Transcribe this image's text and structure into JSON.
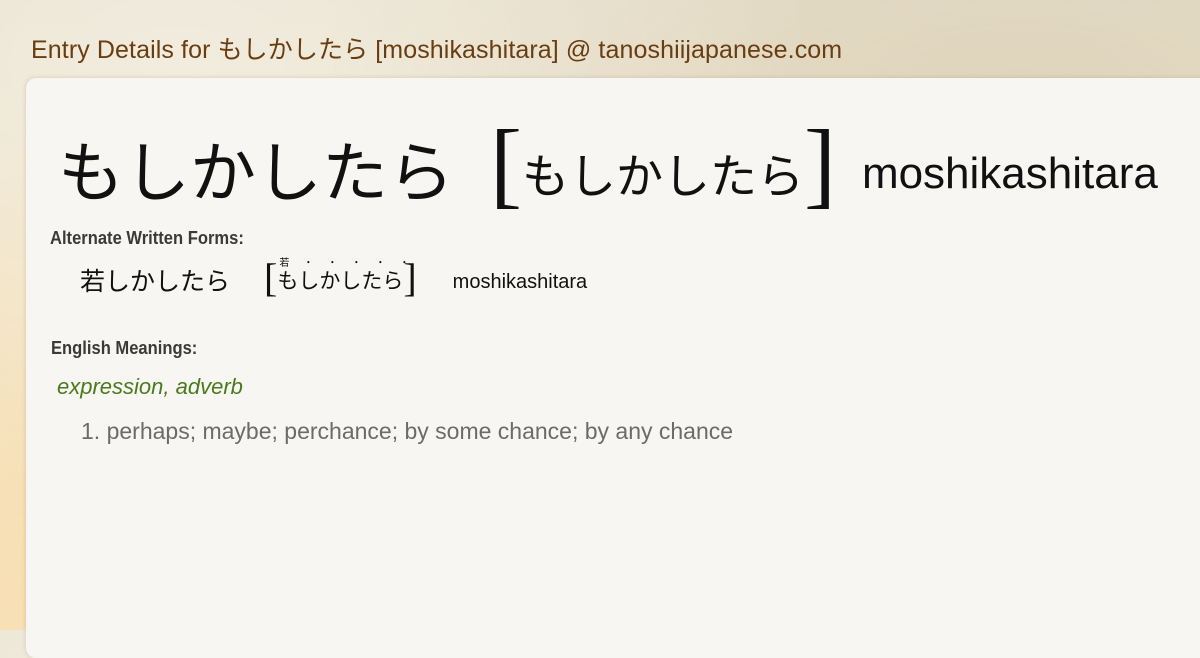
{
  "page": {
    "title": "Entry Details for もしかしたら [moshikashitara] @ tanoshiijapanese.com"
  },
  "entry": {
    "kana": "もしかしたら",
    "bracket_open": "[",
    "reading": "もしかしたら",
    "bracket_close": "]",
    "romaji": "moshikashitara"
  },
  "alternate": {
    "label": "Alternate Written Forms:",
    "written": "若しかしたら",
    "bracket_open": "[",
    "furigana": "若・・・・・",
    "reading": "もしかしたら",
    "bracket_close": "]",
    "romaji": "moshikashitara"
  },
  "meanings": {
    "label": "English Meanings:",
    "part_of_speech": "expression, adverb",
    "items": [
      "1. perhaps; maybe; perchance; by some chance; by any chance"
    ]
  }
}
